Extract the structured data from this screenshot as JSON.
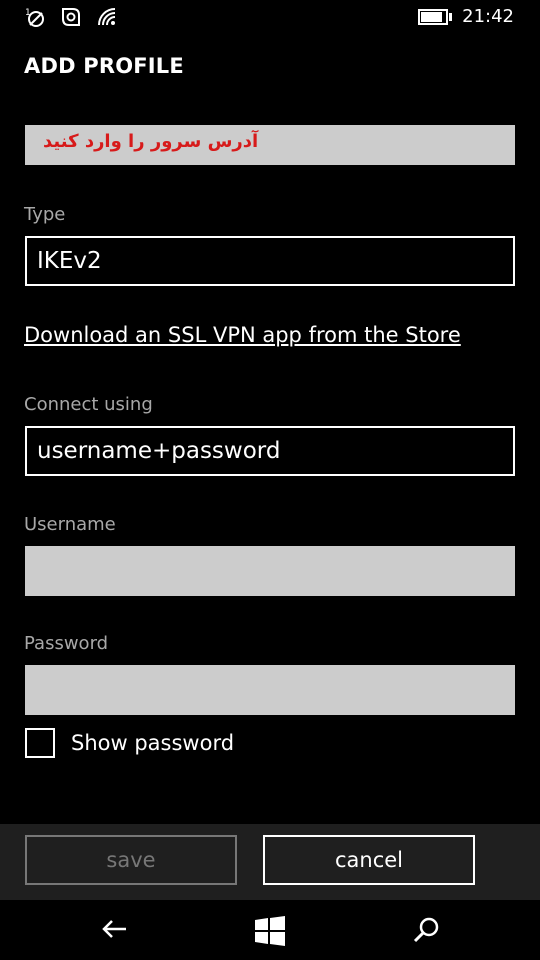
{
  "status_bar": {
    "signal_label": "1",
    "time": "21:42",
    "battery_level": 0.8,
    "icons": [
      "signal-off-icon",
      "data-sense-icon",
      "wifi-icon",
      "battery-icon"
    ]
  },
  "page": {
    "title": "ADD PROFILE"
  },
  "form": {
    "server_value": "آدرس سرور را وارد کنید",
    "type_label": "Type",
    "type_value": "IKEv2",
    "store_link": "Download an SSL VPN app from the Store",
    "connect_label": "Connect using",
    "connect_value": "username+password",
    "username_label": "Username",
    "username_value": "",
    "password_label": "Password",
    "password_value": "",
    "show_password_label": "Show password",
    "show_password_checked": false
  },
  "app_bar": {
    "save_label": "save",
    "cancel_label": "cancel"
  },
  "nav_bar": {
    "icons": [
      "back-icon",
      "windows-start-icon",
      "search-icon"
    ]
  },
  "colors": {
    "background": "#000000",
    "field_gray": "#cccccc",
    "server_text": "#d71a1a",
    "label_gray": "#a8a8a8",
    "appbar_bg": "#1f1f1f",
    "disabled": "#777777"
  }
}
